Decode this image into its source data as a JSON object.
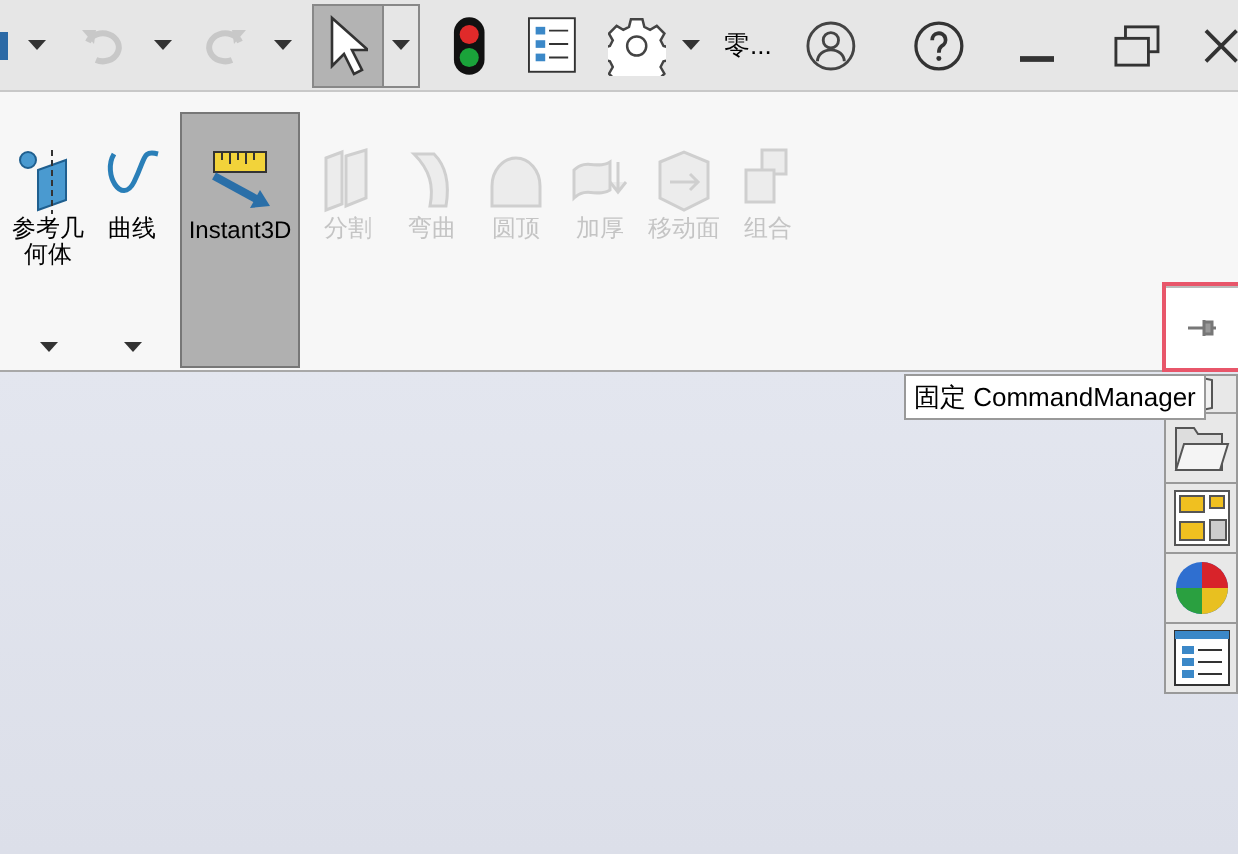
{
  "toolbar": {
    "undo": {
      "disabled": true
    },
    "redo": {
      "disabled": true
    },
    "select": {
      "selected": true
    },
    "menu_label": "零..."
  },
  "ribbon": {
    "tools": [
      {
        "kind": "refgeom",
        "label": "参考几何体",
        "disabled": false,
        "selected": false,
        "dropdown": true
      },
      {
        "kind": "curve",
        "label": "曲线",
        "disabled": false,
        "selected": false,
        "dropdown": true
      },
      {
        "kind": "instant3d",
        "label": "Instant3D",
        "disabled": false,
        "selected": true,
        "dropdown": false
      },
      {
        "kind": "split",
        "label": "分割",
        "disabled": true,
        "selected": false,
        "dropdown": false
      },
      {
        "kind": "flex",
        "label": "弯曲",
        "disabled": true,
        "selected": false,
        "dropdown": false
      },
      {
        "kind": "dome",
        "label": "圆顶",
        "disabled": true,
        "selected": false,
        "dropdown": false
      },
      {
        "kind": "thicken",
        "label": "加厚",
        "disabled": true,
        "selected": false,
        "dropdown": false
      },
      {
        "kind": "moveface",
        "label": "移动面",
        "disabled": true,
        "selected": false,
        "dropdown": false
      },
      {
        "kind": "combine",
        "label": "组合",
        "disabled": true,
        "selected": false,
        "dropdown": false
      }
    ],
    "pin_highlighted": true
  },
  "tooltip": {
    "text": "固定 CommandManager"
  },
  "task_pane": {
    "tabs": [
      {
        "kind": "book"
      },
      {
        "kind": "folder"
      },
      {
        "kind": "palette"
      },
      {
        "kind": "appearance"
      },
      {
        "kind": "properties"
      }
    ]
  }
}
